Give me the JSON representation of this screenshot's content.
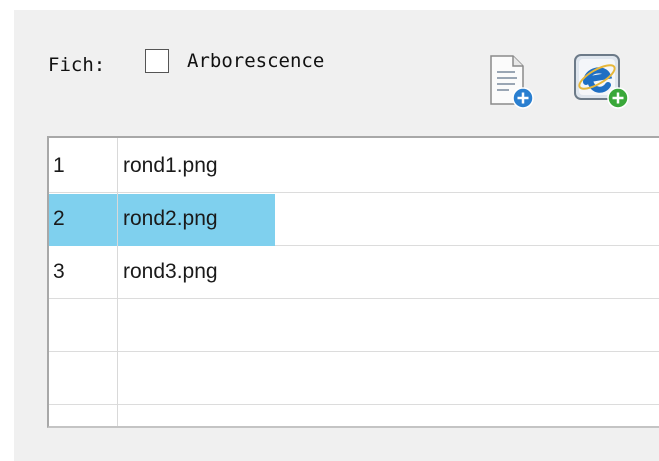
{
  "toolbar": {
    "fich_label": "Fich:",
    "arborescence_label": "Arborescence",
    "arborescence_checked": false,
    "add_file_icon": "add-file-icon",
    "add_web_icon": "add-web-page-icon"
  },
  "list": {
    "rows": [
      {
        "num": "1",
        "name": "rond1.png",
        "selected": false
      },
      {
        "num": "2",
        "name": "rond2.png",
        "selected": true
      },
      {
        "num": "3",
        "name": "rond3.png",
        "selected": false
      },
      {
        "num": "",
        "name": "",
        "selected": false
      },
      {
        "num": "",
        "name": "",
        "selected": false
      },
      {
        "num": "",
        "name": "",
        "selected": false
      }
    ],
    "selection_color": "#7fd0ee"
  }
}
